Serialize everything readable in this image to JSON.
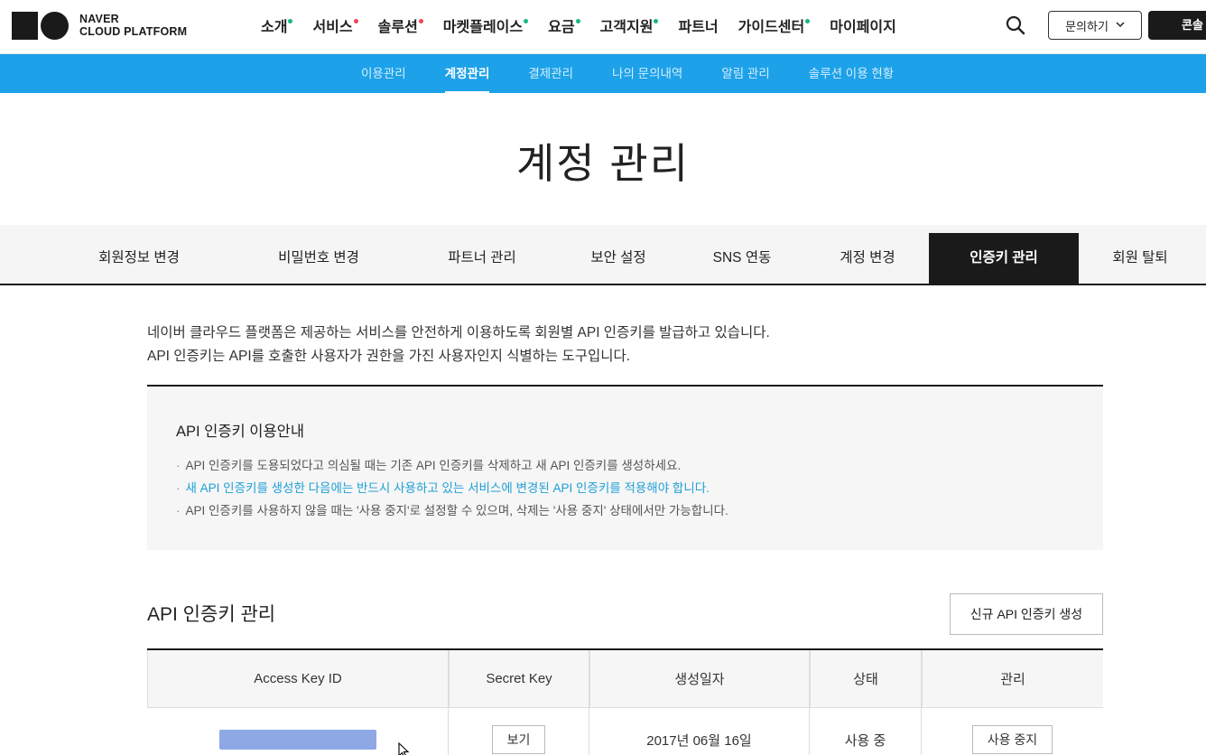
{
  "header": {
    "logo_line1": "NAVER",
    "logo_line2": "CLOUD PLATFORM",
    "nav": [
      {
        "label": "소개",
        "dot": "#1ab77a"
      },
      {
        "label": "서비스",
        "dot": "#f0455a"
      },
      {
        "label": "솔루션",
        "dot": "#f0455a"
      },
      {
        "label": "마켓플레이스",
        "dot": "#1ab77a"
      },
      {
        "label": "요금",
        "dot": "#1ab77a"
      },
      {
        "label": "고객지원",
        "dot": "#1ab77a"
      },
      {
        "label": "파트너",
        "dot": ""
      },
      {
        "label": "가이드센터",
        "dot": "#1ab77a"
      },
      {
        "label": "마이페이지",
        "dot": ""
      }
    ],
    "search_icon": "search-icon",
    "inquiry_label": "문의하기",
    "console_label": "콘솔"
  },
  "subnav": {
    "items": [
      "이용관리",
      "계정관리",
      "결제관리",
      "나의 문의내역",
      "알림 관리",
      "솔루션 이용 현황"
    ],
    "active": "계정관리"
  },
  "page_title": "계정 관리",
  "tabs": {
    "items": [
      "회원정보 변경",
      "비밀번호 변경",
      "파트너 관리",
      "보안 설정",
      "SNS 연동",
      "계정 변경",
      "인증키 관리",
      "회원 탈퇴"
    ],
    "active": "인증키 관리"
  },
  "intro": {
    "line1": "네이버 클라우드 플랫폼은 제공하는 서비스를 안전하게 이용하도록 회원별 API 인증키를 발급하고 있습니다.",
    "line2": "API 인증키는 API를 호출한 사용자가 권한을 가진 사용자인지 식별하는 도구입니다."
  },
  "info": {
    "title": "API 인증키 이용안내",
    "items": [
      "API 인증키를 도용되었다고 의심될 때는 기존 API 인증키를 삭제하고 새 API 인증키를 생성하세요.",
      "새 API 인증키를 생성한 다음에는 반드시 사용하고 있는 서비스에 변경된 API 인증키를 적용해야 합니다.",
      "API 인증키를 사용하지 않을 때는 '사용 중지'로 설정할 수 있으며, 삭제는 '사용 중지' 상태에서만 가능합니다."
    ],
    "bullet": "·",
    "highlight_color": "#1d9fd6"
  },
  "manage": {
    "title": "API 인증키 관리",
    "create_label": "신규 API 인증키 생성",
    "columns": [
      "Access Key ID",
      "Secret Key",
      "생성일자",
      "상태",
      "관리"
    ],
    "rows": [
      {
        "access_key": "••••••••••••••••••••",
        "secret_label": "보기",
        "created": "2017년 06월 16일",
        "status": "사용 중",
        "action_label": "사용 중지"
      }
    ]
  }
}
